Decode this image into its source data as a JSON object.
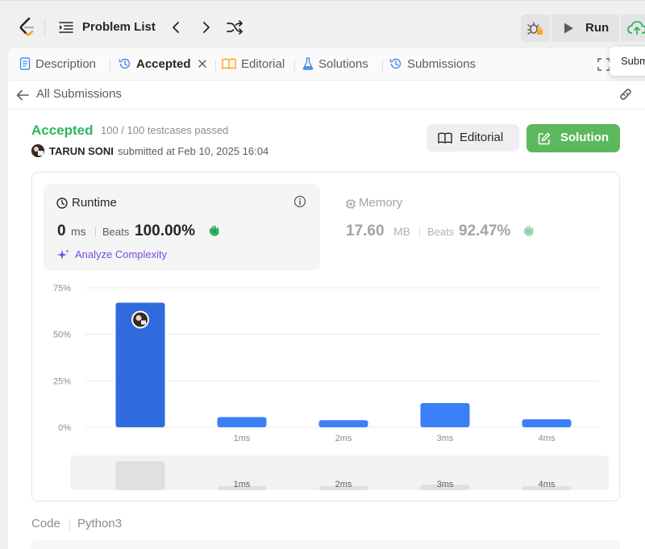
{
  "topbar": {
    "problem_list_label": "Problem List",
    "run_label": "Run"
  },
  "tabs": [
    {
      "label": "Description",
      "icon": "document-icon",
      "active": false
    },
    {
      "label": "Accepted",
      "icon": "history-icon",
      "active": true
    },
    {
      "label": "Editorial",
      "icon": "book-icon",
      "active": false
    },
    {
      "label": "Solutions",
      "icon": "flask-icon",
      "active": false
    },
    {
      "label": "Submissions",
      "icon": "history-icon",
      "active": false
    }
  ],
  "tooltip": "Subm",
  "back_label": "All Submissions",
  "submission": {
    "status": "Accepted",
    "testcases": "100 / 100 testcases passed",
    "author": "TARUN SONI",
    "submitted_at": "submitted at Feb 10, 2025 16:04"
  },
  "buttons": {
    "editorial": "Editorial",
    "solution": "Solution"
  },
  "runtime": {
    "title": "Runtime",
    "value": "0",
    "unit": "ms",
    "beats_label": "Beats",
    "beats_pct": "100.00%",
    "analyze_label": "Analyze Complexity"
  },
  "memory": {
    "title": "Memory",
    "value": "17.60",
    "unit": "MB",
    "beats_label": "Beats",
    "beats_pct": "92.47%"
  },
  "chart_data": {
    "type": "bar",
    "categories": [
      "0ms",
      "1ms",
      "2ms",
      "3ms",
      "4ms"
    ],
    "tick_labels": [
      "",
      "1ms",
      "2ms",
      "3ms",
      "4ms"
    ],
    "values": [
      67,
      5.5,
      3.8,
      13,
      4.3
    ],
    "highlight_index": 0,
    "ylim": [
      0,
      75
    ],
    "yticks": [
      "0%",
      "25%",
      "50%",
      "75%"
    ],
    "ytick_values": [
      0,
      25,
      50,
      75
    ],
    "grid": true,
    "bar_color": "#3a7ff6",
    "highlight_color": "#2f6bdc",
    "overview_tick_labels": [
      "",
      "1ms",
      "2ms",
      "3ms",
      "4ms"
    ]
  },
  "code": {
    "label": "Code",
    "language": "Python3"
  },
  "colors": {
    "accepted": "#2db55d",
    "solution_button": "#5cb85c",
    "analyze": "#7b4be0"
  }
}
